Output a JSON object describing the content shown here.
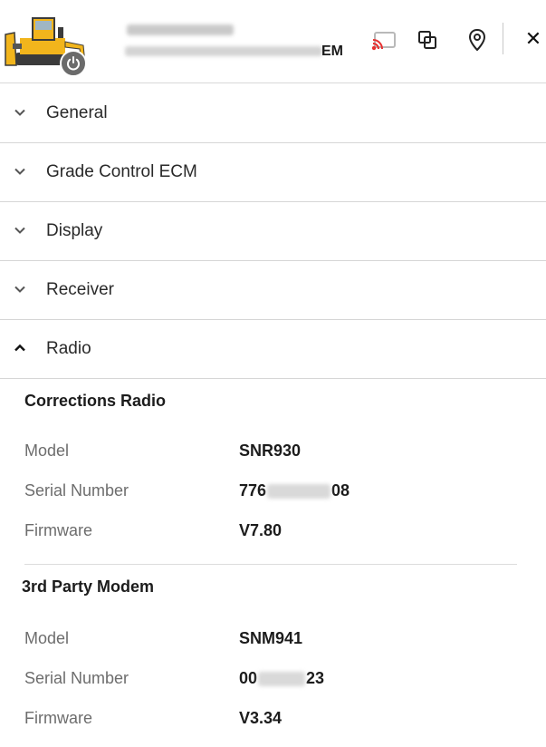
{
  "header": {
    "ecm_suffix": "EM",
    "icons": {
      "machine": "bulldozer-machine-icon",
      "power": "power-icon",
      "cast": "remote-connection-icon",
      "copy": "copy-icon",
      "location": "location-pin-icon",
      "close": "close-icon"
    },
    "close_glyph": "✕",
    "colors": {
      "machine_yellow": "#f2b51c",
      "cast_red": "#e8302f",
      "power_gray": "#6b6b6b"
    }
  },
  "sections": [
    {
      "label": "General",
      "expanded": false
    },
    {
      "label": "Grade Control ECM",
      "expanded": false
    },
    {
      "label": "Display",
      "expanded": false
    },
    {
      "label": "Receiver",
      "expanded": false
    },
    {
      "label": "Radio",
      "expanded": true
    }
  ],
  "radio": {
    "corrections": {
      "title": "Corrections Radio",
      "model_label": "Model",
      "model": "SNR930",
      "serial_label": "Serial Number",
      "serial_prefix": "776",
      "serial_suffix": "08",
      "firmware_label": "Firmware",
      "firmware": "V7.80"
    },
    "modem": {
      "title": "3rd Party Modem",
      "model_label": "Model",
      "model": "SNM941",
      "serial_label": "Serial Number",
      "serial_prefix": "00",
      "serial_suffix": "23",
      "firmware_label": "Firmware",
      "firmware": "V3.34"
    }
  }
}
